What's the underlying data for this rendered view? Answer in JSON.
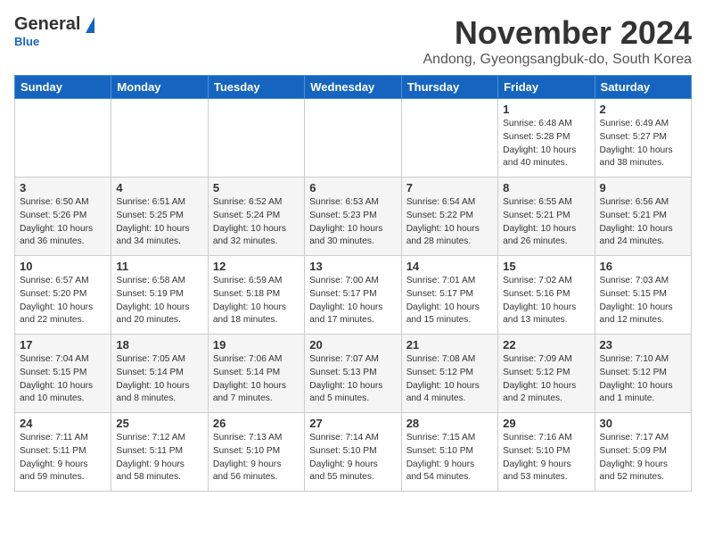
{
  "header": {
    "logo_general": "General",
    "logo_blue": "Blue",
    "month": "November 2024",
    "location": "Andong, Gyeongsangbuk-do, South Korea"
  },
  "days_of_week": [
    "Sunday",
    "Monday",
    "Tuesday",
    "Wednesday",
    "Thursday",
    "Friday",
    "Saturday"
  ],
  "weeks": [
    {
      "row_bg": "odd",
      "days": [
        {
          "date": "",
          "info": ""
        },
        {
          "date": "",
          "info": ""
        },
        {
          "date": "",
          "info": ""
        },
        {
          "date": "",
          "info": ""
        },
        {
          "date": "",
          "info": ""
        },
        {
          "date": "1",
          "info": "Sunrise: 6:48 AM\nSunset: 5:28 PM\nDaylight: 10 hours\nand 40 minutes."
        },
        {
          "date": "2",
          "info": "Sunrise: 6:49 AM\nSunset: 5:27 PM\nDaylight: 10 hours\nand 38 minutes."
        }
      ]
    },
    {
      "row_bg": "even",
      "days": [
        {
          "date": "3",
          "info": "Sunrise: 6:50 AM\nSunset: 5:26 PM\nDaylight: 10 hours\nand 36 minutes."
        },
        {
          "date": "4",
          "info": "Sunrise: 6:51 AM\nSunset: 5:25 PM\nDaylight: 10 hours\nand 34 minutes."
        },
        {
          "date": "5",
          "info": "Sunrise: 6:52 AM\nSunset: 5:24 PM\nDaylight: 10 hours\nand 32 minutes."
        },
        {
          "date": "6",
          "info": "Sunrise: 6:53 AM\nSunset: 5:23 PM\nDaylight: 10 hours\nand 30 minutes."
        },
        {
          "date": "7",
          "info": "Sunrise: 6:54 AM\nSunset: 5:22 PM\nDaylight: 10 hours\nand 28 minutes."
        },
        {
          "date": "8",
          "info": "Sunrise: 6:55 AM\nSunset: 5:21 PM\nDaylight: 10 hours\nand 26 minutes."
        },
        {
          "date": "9",
          "info": "Sunrise: 6:56 AM\nSunset: 5:21 PM\nDaylight: 10 hours\nand 24 minutes."
        }
      ]
    },
    {
      "row_bg": "odd",
      "days": [
        {
          "date": "10",
          "info": "Sunrise: 6:57 AM\nSunset: 5:20 PM\nDaylight: 10 hours\nand 22 minutes."
        },
        {
          "date": "11",
          "info": "Sunrise: 6:58 AM\nSunset: 5:19 PM\nDaylight: 10 hours\nand 20 minutes."
        },
        {
          "date": "12",
          "info": "Sunrise: 6:59 AM\nSunset: 5:18 PM\nDaylight: 10 hours\nand 18 minutes."
        },
        {
          "date": "13",
          "info": "Sunrise: 7:00 AM\nSunset: 5:17 PM\nDaylight: 10 hours\nand 17 minutes."
        },
        {
          "date": "14",
          "info": "Sunrise: 7:01 AM\nSunset: 5:17 PM\nDaylight: 10 hours\nand 15 minutes."
        },
        {
          "date": "15",
          "info": "Sunrise: 7:02 AM\nSunset: 5:16 PM\nDaylight: 10 hours\nand 13 minutes."
        },
        {
          "date": "16",
          "info": "Sunrise: 7:03 AM\nSunset: 5:15 PM\nDaylight: 10 hours\nand 12 minutes."
        }
      ]
    },
    {
      "row_bg": "even",
      "days": [
        {
          "date": "17",
          "info": "Sunrise: 7:04 AM\nSunset: 5:15 PM\nDaylight: 10 hours\nand 10 minutes."
        },
        {
          "date": "18",
          "info": "Sunrise: 7:05 AM\nSunset: 5:14 PM\nDaylight: 10 hours\nand 8 minutes."
        },
        {
          "date": "19",
          "info": "Sunrise: 7:06 AM\nSunset: 5:14 PM\nDaylight: 10 hours\nand 7 minutes."
        },
        {
          "date": "20",
          "info": "Sunrise: 7:07 AM\nSunset: 5:13 PM\nDaylight: 10 hours\nand 5 minutes."
        },
        {
          "date": "21",
          "info": "Sunrise: 7:08 AM\nSunset: 5:12 PM\nDaylight: 10 hours\nand 4 minutes."
        },
        {
          "date": "22",
          "info": "Sunrise: 7:09 AM\nSunset: 5:12 PM\nDaylight: 10 hours\nand 2 minutes."
        },
        {
          "date": "23",
          "info": "Sunrise: 7:10 AM\nSunset: 5:12 PM\nDaylight: 10 hours\nand 1 minute."
        }
      ]
    },
    {
      "row_bg": "odd",
      "days": [
        {
          "date": "24",
          "info": "Sunrise: 7:11 AM\nSunset: 5:11 PM\nDaylight: 9 hours\nand 59 minutes."
        },
        {
          "date": "25",
          "info": "Sunrise: 7:12 AM\nSunset: 5:11 PM\nDaylight: 9 hours\nand 58 minutes."
        },
        {
          "date": "26",
          "info": "Sunrise: 7:13 AM\nSunset: 5:10 PM\nDaylight: 9 hours\nand 56 minutes."
        },
        {
          "date": "27",
          "info": "Sunrise: 7:14 AM\nSunset: 5:10 PM\nDaylight: 9 hours\nand 55 minutes."
        },
        {
          "date": "28",
          "info": "Sunrise: 7:15 AM\nSunset: 5:10 PM\nDaylight: 9 hours\nand 54 minutes."
        },
        {
          "date": "29",
          "info": "Sunrise: 7:16 AM\nSunset: 5:10 PM\nDaylight: 9 hours\nand 53 minutes."
        },
        {
          "date": "30",
          "info": "Sunrise: 7:17 AM\nSunset: 5:09 PM\nDaylight: 9 hours\nand 52 minutes."
        }
      ]
    }
  ]
}
